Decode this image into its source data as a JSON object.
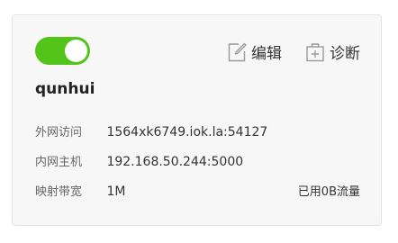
{
  "card": {
    "enabled": true,
    "title": "qunhui",
    "actions": {
      "edit_label": "编辑",
      "diagnose_label": "诊断"
    },
    "rows": [
      {
        "label": "外网访问",
        "value": "1564xk6749.iok.la:54127"
      },
      {
        "label": "内网主机",
        "value": "192.168.50.244:5000"
      },
      {
        "label": "映射带宽",
        "value": "1M"
      }
    ],
    "usage": "已用0B流量"
  },
  "colors": {
    "toggle_on": "#52c41a",
    "icon": "#9a9a9a"
  },
  "icons": {
    "edit": "edit-icon",
    "diagnose": "diagnose-icon"
  }
}
